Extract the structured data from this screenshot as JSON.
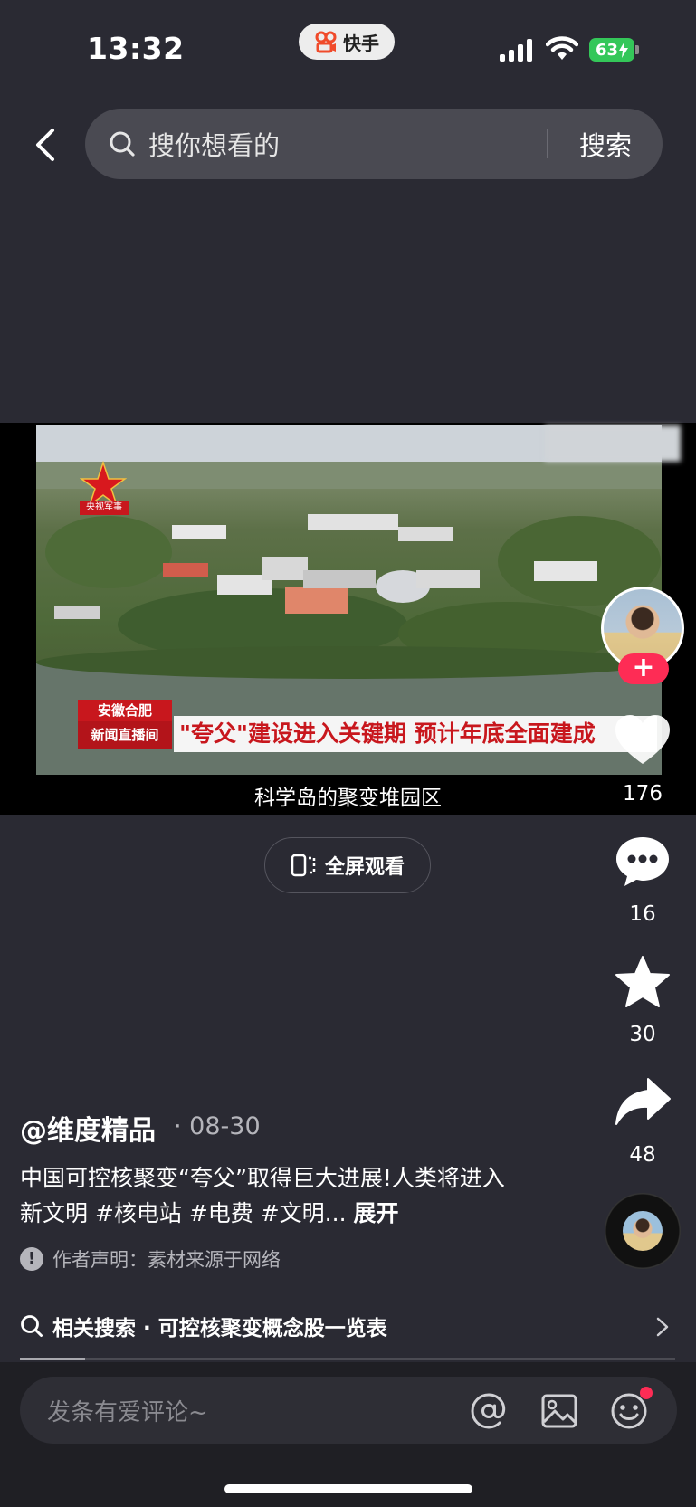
{
  "status_bar": {
    "time": "13:32",
    "app_name": "快手",
    "battery": "63"
  },
  "search": {
    "placeholder": "搜你想看的",
    "submit_label": "搜索"
  },
  "video": {
    "channel_label": "央视军事",
    "location_tag": "安徽合肥",
    "program_tag": "新闻直播间",
    "headline": "\"夸父\"建设进入关键期 预计年底全面建成",
    "caption": "科学岛的聚变堆园区"
  },
  "rail": {
    "likes": "176",
    "comments": "16",
    "favorites": "30",
    "shares": "48",
    "follow_symbol": "+"
  },
  "fullscreen_label": "全屏观看",
  "post": {
    "author": "@维度精品",
    "date": "· 08-30",
    "description": "中国可控核聚变“夸父”取得巨大进展!人类将进入新文明 #核电站 #电费 #文明...",
    "expand_label": "展开",
    "declaration": "作者声明：素材来源于网络"
  },
  "related_search": "相关搜索 · 可控核聚变概念股一览表",
  "progress": 0.1,
  "comment": {
    "placeholder": "发条有爱评论~"
  },
  "colors": {
    "accent": "#fe2c55",
    "background": "#2a2a33",
    "battery": "#34c759",
    "headline_red": "#c8171d"
  },
  "icons": [
    "back-icon",
    "search-icon",
    "heart-icon",
    "comment-icon",
    "star-icon",
    "share-icon",
    "fullscreen-icon",
    "warning-icon",
    "chevron-right-icon",
    "at-icon",
    "image-icon",
    "emoji-icon"
  ]
}
